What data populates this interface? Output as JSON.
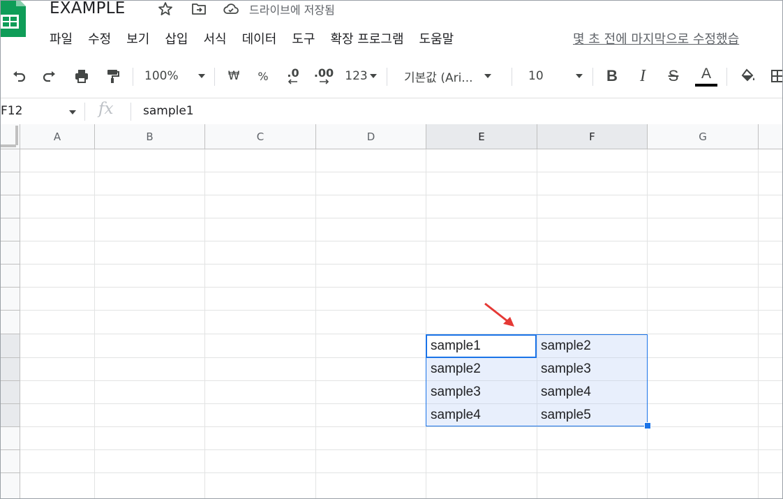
{
  "app": {
    "doc_title": "EXAMPLE",
    "save_status": "드라이브에 저장됨",
    "brand_color": "#0f9d58"
  },
  "title_icons": [
    "star-icon",
    "move-to-folder-icon",
    "cloud-saved-icon"
  ],
  "menu": {
    "items": [
      "파일",
      "수정",
      "보기",
      "삽입",
      "서식",
      "데이터",
      "도구",
      "확장 프로그램",
      "도움말"
    ],
    "last_edit": "몇 초 전에 마지막으로 수정했습"
  },
  "toolbar": {
    "zoom": "100%",
    "currency": "₩",
    "percent": "%",
    "decimal_decrease": ".0",
    "decimal_increase": ".00",
    "number_format": "123",
    "font": "기본값 (Ari...",
    "font_size": "10",
    "bold": "B",
    "italic": "I",
    "strikethrough": "S",
    "text_color_letter": "A"
  },
  "formula_bar": {
    "name_box": "F12",
    "fx": "fx",
    "value": "sample1"
  },
  "grid": {
    "columns": [
      "A",
      "B",
      "C",
      "D",
      "E",
      "F",
      "G"
    ],
    "selected_columns": [
      "E",
      "F"
    ],
    "cells": [
      [
        "sample1",
        "sample2"
      ],
      [
        "sample2",
        "sample3"
      ],
      [
        "sample3",
        "sample4"
      ],
      [
        "sample4",
        "sample5"
      ]
    ],
    "selection_color": "#1a73e8",
    "annotation_color": "#e53935"
  }
}
